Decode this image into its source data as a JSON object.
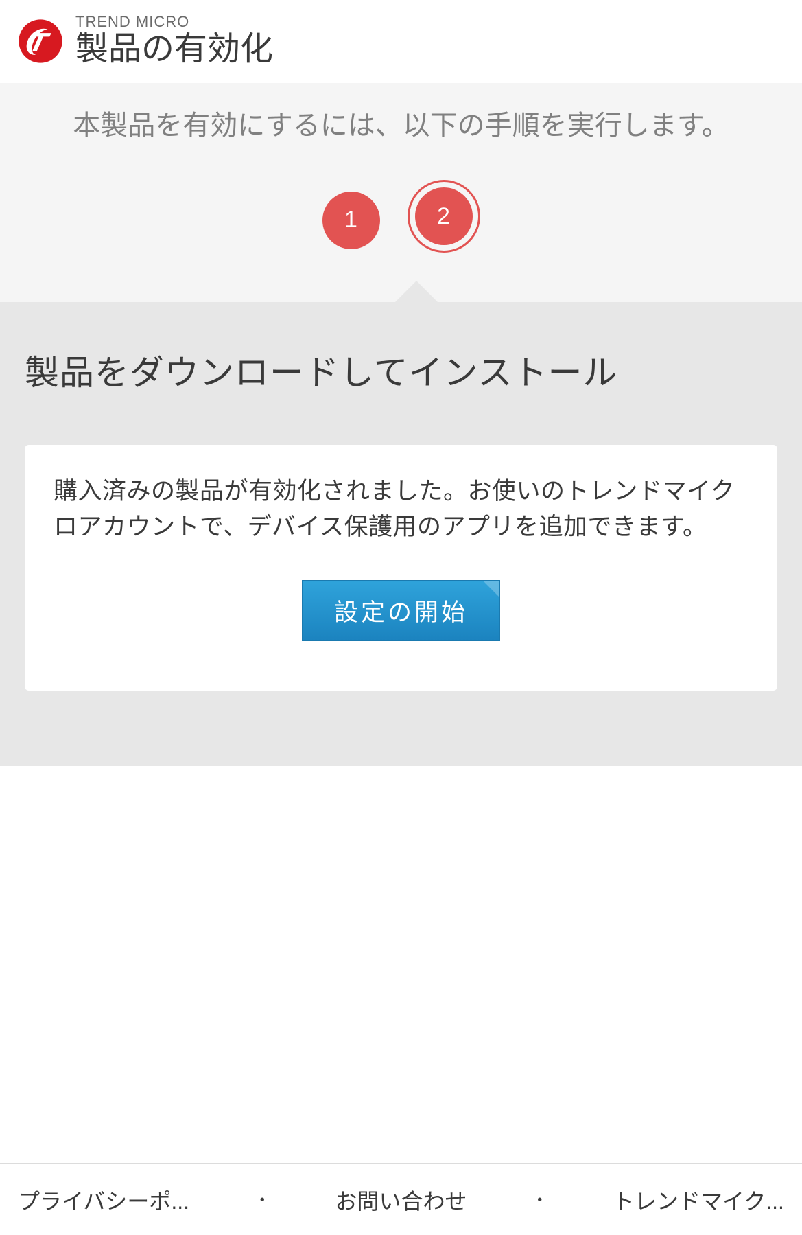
{
  "header": {
    "brand": "TREND MICRO",
    "title": "製品の有効化"
  },
  "intro": {
    "text": "本製品を有効にするには、以下の手順を実行します。"
  },
  "steps": {
    "step1": "1",
    "step2": "2"
  },
  "main": {
    "title": "製品をダウンロードしてインストール",
    "card_text": "購入済みの製品が有効化されました。お使いのトレンドマイクロアカウントで、デバイス保護用のアプリを追加できます。",
    "cta_label": "設定の開始"
  },
  "footer": {
    "link1": "プライバシーポ...",
    "link2": "お問い合わせ",
    "link3": "トレンドマイク..."
  }
}
